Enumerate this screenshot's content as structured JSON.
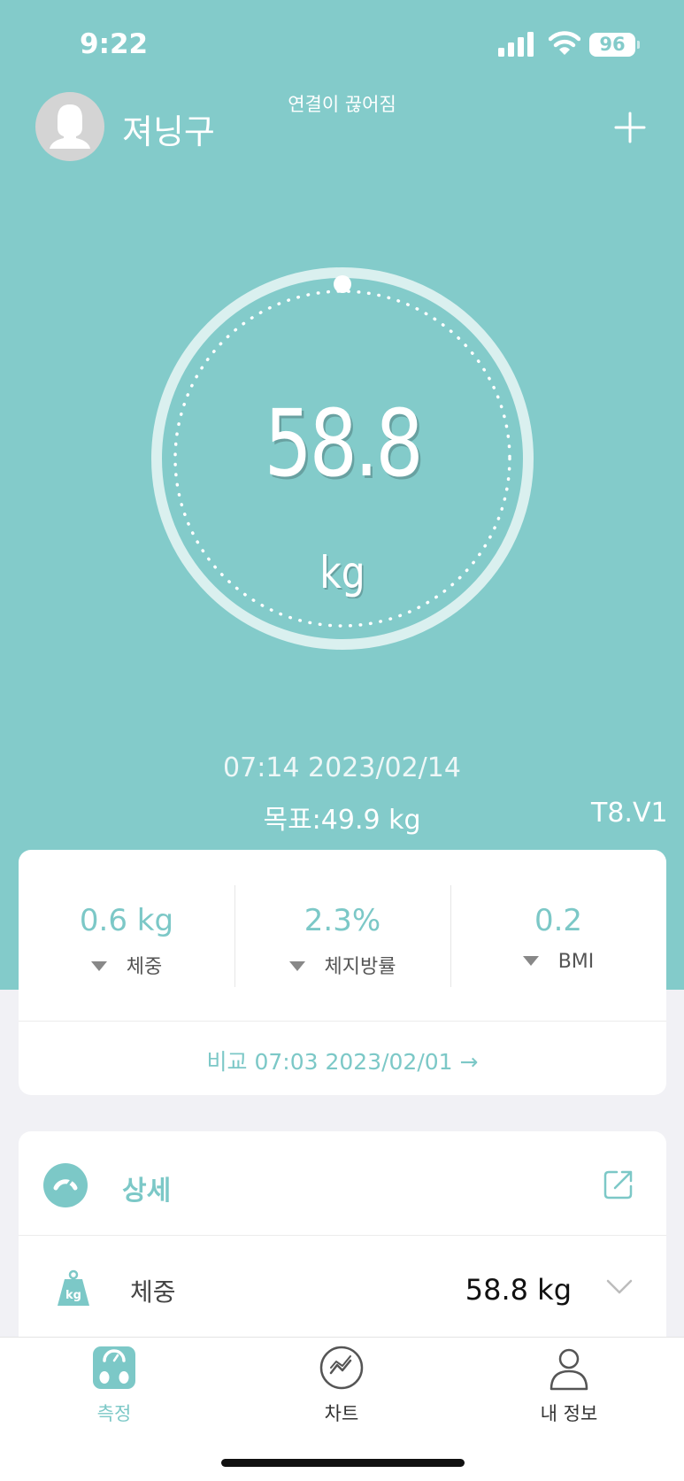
{
  "status_bar": {
    "time": "9:22",
    "battery": "96"
  },
  "header": {
    "user_name": "져닝구",
    "connection_status": "연결이 끊어짐"
  },
  "measurement": {
    "weight_value": "58.8",
    "weight_unit": "kg",
    "datetime": "07:14 2023/02/14",
    "goal": "목표:49.9 kg",
    "device": "T8.V1"
  },
  "comparison": {
    "stats": [
      {
        "value": "0.6 kg",
        "label": "체중"
      },
      {
        "value": "2.3%",
        "label": "체지방률"
      },
      {
        "value": "0.2",
        "label": "BMI"
      }
    ],
    "compare_link": "비교 07:03 2023/02/01 →"
  },
  "detail": {
    "title": "상세",
    "rows": [
      {
        "label": "체중",
        "value": "58.8 kg",
        "icon": "kg"
      }
    ]
  },
  "tabs": [
    {
      "label": "측정",
      "active": true
    },
    {
      "label": "차트",
      "active": false
    },
    {
      "label": "내 정보",
      "active": false
    }
  ],
  "colors": {
    "accent": "#83cbca",
    "accent_text": "#7cc8c7"
  }
}
